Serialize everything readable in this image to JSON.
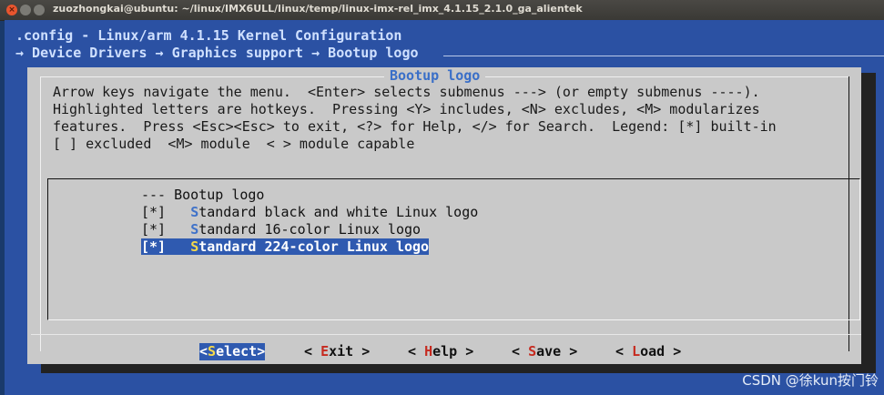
{
  "window": {
    "title": "zuozhongkai@ubuntu: ~/linux/IMX6ULL/linux/temp/linux-imx-rel_imx_4.1.15_2.1.0_ga_alientek",
    "buttons": {
      "close": "×",
      "minimize": "",
      "maximize": ""
    }
  },
  "header": {
    "config_title": ".config - Linux/arm 4.1.15 Kernel Configuration",
    "breadcrumb": "→ Device Drivers → Graphics support → Bootup logo"
  },
  "dialog": {
    "title": "Bootup logo",
    "help_lines": [
      "Arrow keys navigate the menu.  <Enter> selects submenus ---> (or empty submenus ----).",
      "Highlighted letters are hotkeys.  Pressing <Y> includes, <N> excludes, <M> modularizes",
      "features.  Press <Esc><Esc> to exit, <?> for Help, </> for Search.  Legend: [*] built-in",
      "[ ] excluded  <M> module  < > module capable"
    ],
    "menu": [
      {
        "prefix": "--- ",
        "hot": "",
        "rest": "Bootup logo",
        "selected": false
      },
      {
        "prefix": "[*]   ",
        "hot": "S",
        "rest": "tandard black and white Linux logo",
        "selected": false
      },
      {
        "prefix": "[*]   ",
        "hot": "S",
        "rest": "tandard 16-color Linux logo",
        "selected": false
      },
      {
        "prefix": "[*]   ",
        "hot": "S",
        "rest": "tandard 224-color Linux logo",
        "selected": true
      }
    ],
    "buttons": [
      {
        "left": "<",
        "hot": "S",
        "rest": "elect>",
        "active": true
      },
      {
        "left": "< ",
        "hot": "E",
        "rest": "xit >",
        "active": false
      },
      {
        "left": "< ",
        "hot": "H",
        "rest": "elp >",
        "active": false
      },
      {
        "left": "< ",
        "hot": "S",
        "rest": "ave >",
        "active": false
      },
      {
        "left": "< ",
        "hot": "L",
        "rest": "oad >",
        "active": false
      }
    ]
  },
  "watermark": "CSDN @徐kun按门铃",
  "colors": {
    "terminal_bg": "#2b51a3",
    "dialog_bg": "#c9c9c9",
    "selection_bg": "#2f5ab0",
    "menu_hotkey": "#3f72c9",
    "button_hotkey": "#c62a1f",
    "selected_hotkey": "#f5d94a"
  }
}
